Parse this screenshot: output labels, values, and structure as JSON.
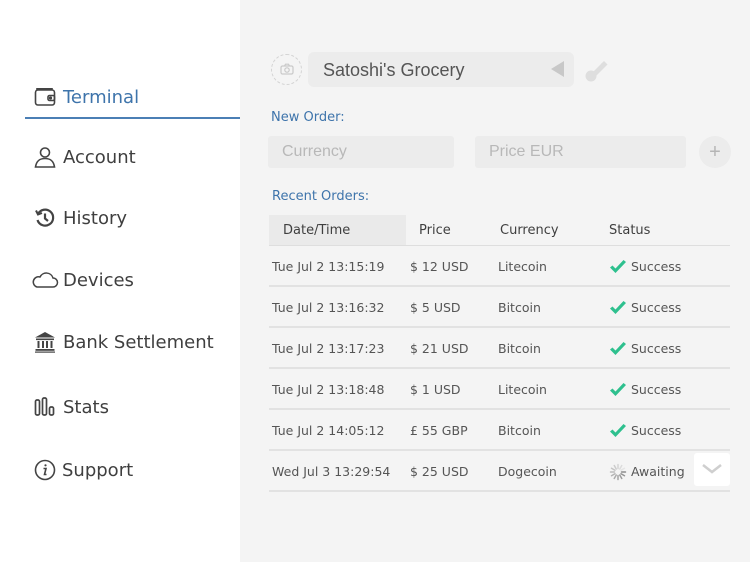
{
  "sidebar": {
    "items": [
      {
        "label": "Terminal",
        "icon": "wallet-icon",
        "active": true
      },
      {
        "label": "Account",
        "icon": "user-icon",
        "active": false
      },
      {
        "label": "History",
        "icon": "history-icon",
        "active": false
      },
      {
        "label": "Devices",
        "icon": "cloud-icon",
        "active": false
      },
      {
        "label": "Bank Settlement",
        "icon": "bank-icon",
        "active": false
      },
      {
        "label": "Stats",
        "icon": "bar-chart-icon",
        "active": false
      },
      {
        "label": "Support",
        "icon": "info-icon",
        "active": false
      }
    ]
  },
  "header": {
    "merchant_name": "Satoshi's Grocery",
    "camera_icon": "camera-icon",
    "toggle_icon": "triangle-left-icon",
    "key_icon": "key-icon"
  },
  "new_order": {
    "label": "New Order:",
    "currency_value": "",
    "currency_placeholder": "Currency",
    "price_value": "",
    "price_placeholder": "Price EUR",
    "add_label": "+"
  },
  "recent_orders": {
    "label": "Recent Orders:",
    "columns": [
      "Date/Time",
      "Price",
      "Currency",
      "Status"
    ],
    "rows": [
      {
        "datetime": "Tue Jul 2 13:15:19",
        "price": "$ 12 USD",
        "currency": "Litecoin",
        "status": "Success",
        "status_icon": "checkmark-icon"
      },
      {
        "datetime": "Tue Jul 2 13:16:32",
        "price": "$ 5 USD",
        "currency": "Bitcoin",
        "status": "Success",
        "status_icon": "checkmark-icon"
      },
      {
        "datetime": "Tue Jul 2 13:17:23",
        "price": "$ 21 USD",
        "currency": "Bitcoin",
        "status": "Success",
        "status_icon": "checkmark-icon"
      },
      {
        "datetime": "Tue Jul 2 13:18:48",
        "price": "$ 1 USD",
        "currency": "Litecoin",
        "status": "Success",
        "status_icon": "checkmark-icon"
      },
      {
        "datetime": "Tue Jul 2 14:05:12",
        "price": "£ 55 GBP",
        "currency": "Bitcoin",
        "status": "Success",
        "status_icon": "checkmark-icon"
      },
      {
        "datetime": "Wed Jul 3 13:29:54",
        "price": "$ 25 USD",
        "currency": "Dogecoin",
        "status": "Awaiting",
        "status_icon": "spinner-icon"
      }
    ]
  },
  "colors": {
    "accent": "#3e74ab",
    "success": "#2ec08e",
    "sidebar_bg": "#ffffff",
    "main_bg": "#f4f4f4"
  }
}
